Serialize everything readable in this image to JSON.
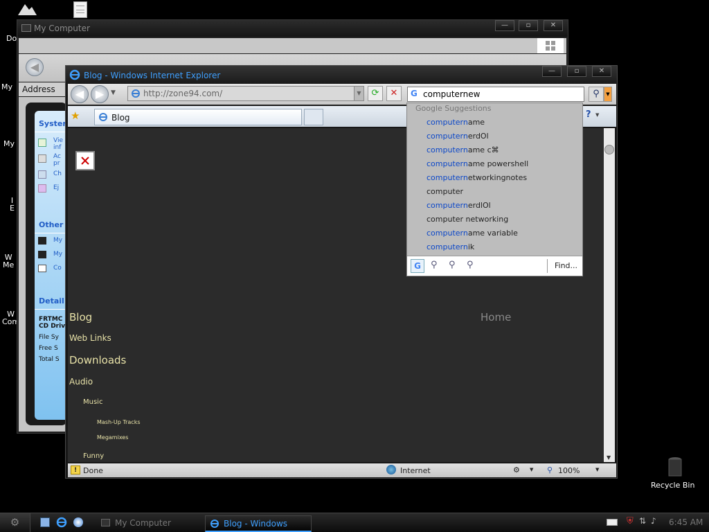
{
  "desktop": {
    "labels": [
      {
        "text": "Do"
      },
      {
        "text": "My"
      },
      {
        "text": "My"
      },
      {
        "text": "I\nE"
      },
      {
        "text": "W\nMe"
      },
      {
        "text": "W\nCom"
      }
    ],
    "recycle_bin": "Recycle Bin"
  },
  "mycomputer": {
    "title": "My Computer",
    "address_label": "Address",
    "sidebar": {
      "system_heading": "Syster",
      "system_items": [
        "Vie\ninf",
        "Ac\npr",
        "Ch",
        "Ej"
      ],
      "other_heading": "Other",
      "other_items": [
        "My",
        "My",
        "Co"
      ],
      "details_heading": "Detail",
      "details_lines": [
        "FRTMC",
        "CD Driv",
        "File Sy",
        "Free S",
        "Total S"
      ]
    }
  },
  "ie": {
    "title": "Blog - Windows Internet Explorer",
    "address": "http://zone94.com/",
    "search_value": "computernew",
    "tab_label": "Blog",
    "suggestions": {
      "heading": "Google Suggestions",
      "items": [
        {
          "prefix": "computern",
          "rest": "ame",
          "hl": true
        },
        {
          "prefix": "computern",
          "rest": "erdOl",
          "hl": true
        },
        {
          "prefix": "computern",
          "rest": "ame c⌘",
          "hl": true
        },
        {
          "prefix": "computern",
          "rest": "ame powershell",
          "hl": true
        },
        {
          "prefix": "computern",
          "rest": "etworkingnotes",
          "hl": true
        },
        {
          "prefix": "computer",
          "rest": "",
          "hl": false
        },
        {
          "prefix": "computern",
          "rest": "erdlOl",
          "hl": true
        },
        {
          "prefix": "computer networking",
          "rest": "",
          "hl": false
        },
        {
          "prefix": "computern",
          "rest": "ame variable",
          "hl": true
        },
        {
          "prefix": "computern",
          "rest": "ik",
          "hl": true
        }
      ],
      "find_label": "Find..."
    },
    "page": {
      "blog": "Blog",
      "home": "Home",
      "web_links": "Web Links",
      "downloads": "Downloads",
      "audio": "Audio",
      "music": "Music",
      "mashup": "Mash-Up Tracks",
      "megamixes": "Megamixes",
      "funny": "Funny"
    },
    "status": {
      "done": "Done",
      "zone": "Internet",
      "zoom": "100%"
    }
  },
  "taskbar": {
    "tasks": [
      {
        "label": "My Computer"
      },
      {
        "label": "Blog - Windows Inter..."
      }
    ],
    "clock": "6:45 AM"
  },
  "colors": {
    "accent": "#3fa0ff",
    "link": "#e8e2a8",
    "page_bg": "#2b2b2b"
  }
}
